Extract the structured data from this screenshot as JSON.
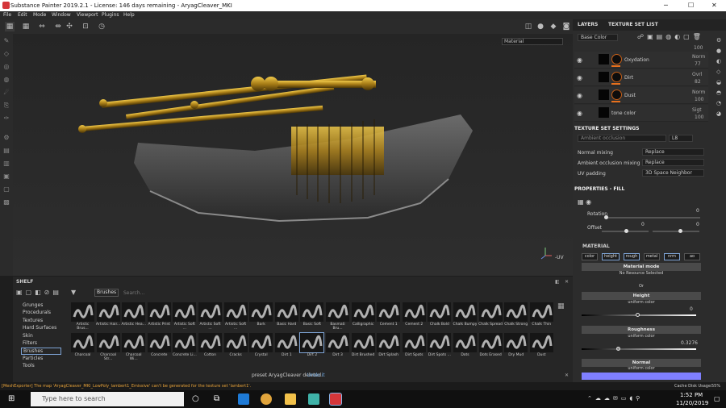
{
  "window": {
    "title": "Substance Painter 2019.2.1 - License: 146 days remaining - AryagCleaver_MKI"
  },
  "menu": [
    "File",
    "Edit",
    "Mode",
    "Window",
    "Viewport",
    "Plugins",
    "Help"
  ],
  "viewport": {
    "material_mode": "Material"
  },
  "layers": {
    "tabs": [
      "LAYERS",
      "TEXTURE SET LIST"
    ],
    "channel": "Base Color",
    "top_opacity": "100",
    "items": [
      {
        "name": "Oxydation",
        "blend": "Norm",
        "opacity": "77"
      },
      {
        "name": "Dirt",
        "blend": "Ovrl",
        "opacity": "82"
      },
      {
        "name": "Dust",
        "blend": "Norm",
        "opacity": "100"
      },
      {
        "name": "tone color",
        "blend": "Sigt",
        "opacity": "100"
      }
    ]
  },
  "texture_set_settings": {
    "title": "TEXTURE SET SETTINGS",
    "ao_placeholder": "Ambient occlusion",
    "ao_value": "L8",
    "rows": [
      {
        "label": "Normal mixing",
        "value": "Replace"
      },
      {
        "label": "Ambient occlusion mixing",
        "value": "Replace"
      },
      {
        "label": "UV padding",
        "value": "3D Space Neighbor"
      }
    ]
  },
  "properties": {
    "title": "PROPERTIES - FILL",
    "rotation_label": "Rotation",
    "rotation_value": "0",
    "offset_label": "Offset",
    "offset_x": "0",
    "offset_y": "0",
    "material_title": "MATERIAL",
    "channels": [
      "color",
      "height",
      "rough",
      "metal",
      "nrm",
      "ao"
    ],
    "material_mode": "Material mode",
    "no_resource": "No Resource Selected",
    "or": "Or",
    "height": {
      "title": "Height",
      "sub": "uniform color",
      "value": "0"
    },
    "roughness": {
      "title": "Roughness",
      "sub": "uniform color",
      "value": "0.3276"
    },
    "normal": {
      "title": "Normal",
      "sub": "uniform color"
    },
    "cache": "Cache Disk Usage:",
    "cache_value": "55%"
  },
  "shelf": {
    "title": "SHELF",
    "filter": "Brushes",
    "search_placeholder": "Search...",
    "categories": [
      "Grunges",
      "Procedurals",
      "Textures",
      "Hard Surfaces",
      "Skin",
      "Filters",
      "Brushes",
      "Particles",
      "Tools"
    ],
    "brushes_row1": [
      "Artistic Brus...",
      "Artistic Hair...",
      "Artistic Hea...",
      "Artistic Print",
      "Artistic Soft ...",
      "Artistic Soft ...",
      "Artistic Soft ...",
      "Bark",
      "Basic Hard",
      "Basic Soft",
      "Basmati Bru...",
      "Calligraphic",
      "Cement 1",
      "Cement 2",
      "Chalk Bold",
      "Chalk Bumpy",
      "Chalk Spread",
      "Chalk Strong",
      "Chalk Thin"
    ],
    "brushes_row2": [
      "Charcoal",
      "Charcoal Str...",
      "Charcoal Wi...",
      "Concrete",
      "Concrete Li...",
      "Cotton",
      "Cracks",
      "Crystal",
      "Dirt 1",
      "Dirt 2",
      "Dirt 3",
      "Dirt Brushed",
      "Dirt Splash",
      "Dirt Spots",
      "Dirt Spots ...",
      "Dots",
      "Dots Erased",
      "Dry Mud",
      "Dust"
    ],
    "notification": "preset AryagCleaver deleted.",
    "undo": "Undo it"
  },
  "status": "[MeshExporter] The map 'AryagCleaver_MKI_LowPoly_lambert1_Emissive' can't be generated for the texture set 'lambert1'.",
  "taskbar": {
    "search_placeholder": "Type here to search",
    "time": "1:52 PM",
    "date": "11/20/2019"
  }
}
